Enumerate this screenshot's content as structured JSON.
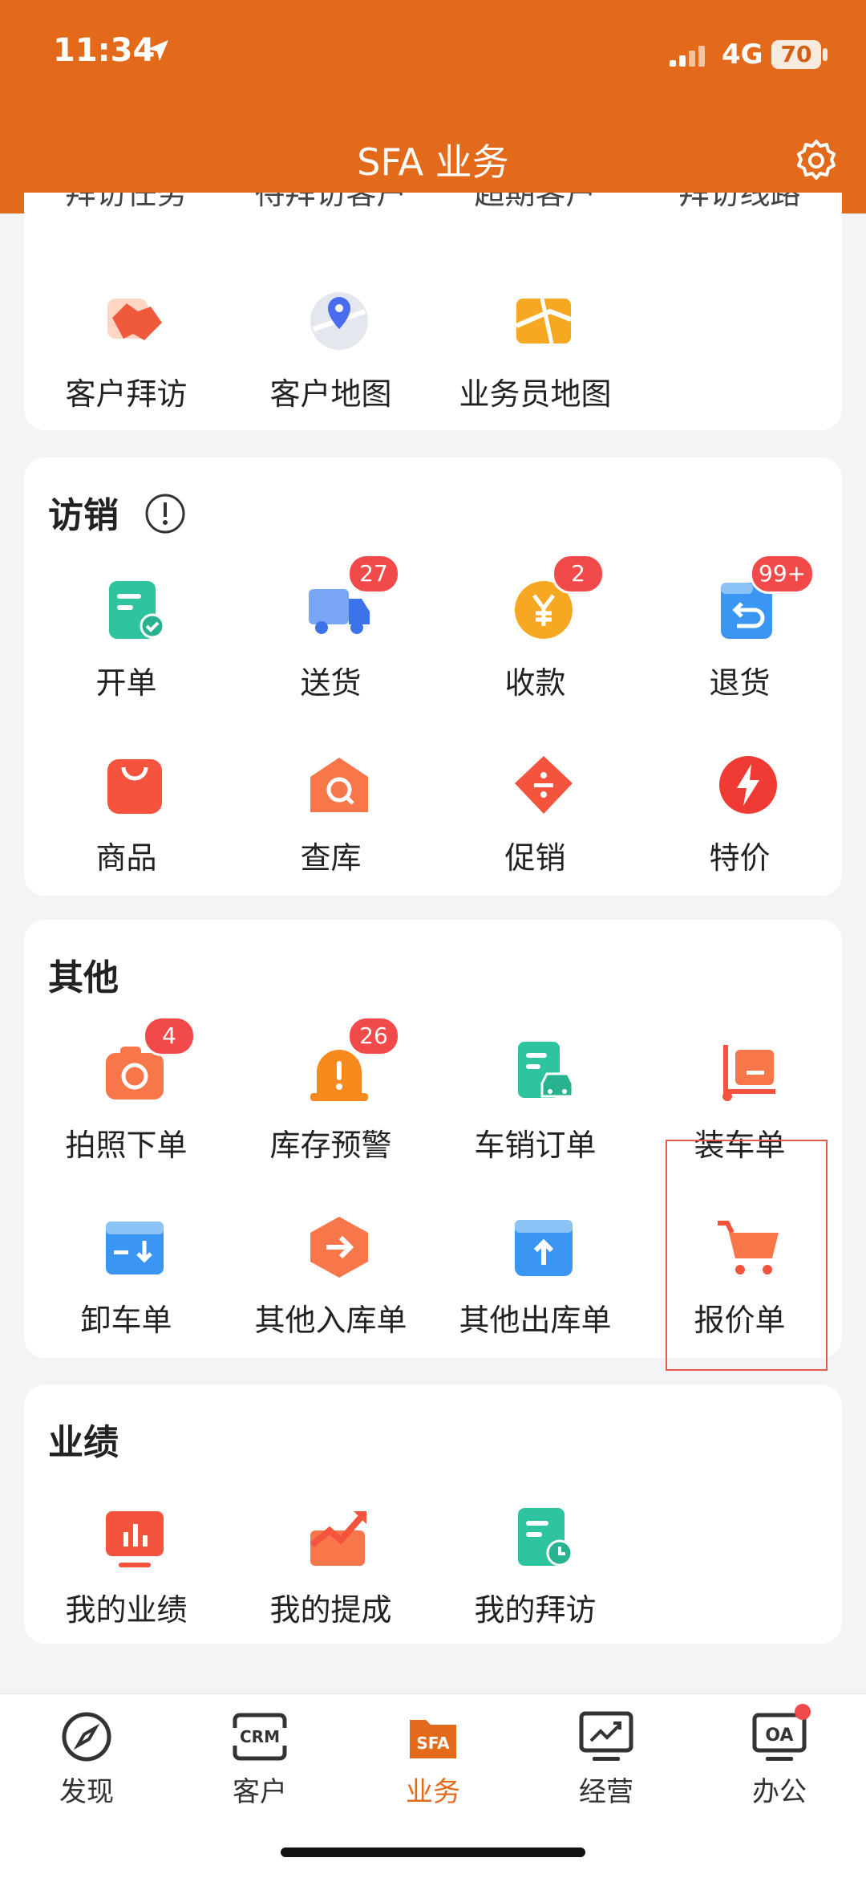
{
  "status": {
    "time": "11:34",
    "network": "4G",
    "battery": "70"
  },
  "header": {
    "title": "SFA 业务"
  },
  "top_card": {
    "clipped_labels": [
      "拜访任务",
      "待拜访客户",
      "超期客户",
      "拜访线路"
    ],
    "items": [
      {
        "label": "客户拜访",
        "icon": "handshake-icon"
      },
      {
        "label": "客户地图",
        "icon": "map-pin-icon"
      },
      {
        "label": "业务员地图",
        "icon": "map-icon"
      }
    ]
  },
  "visit": {
    "title": "访销",
    "items": [
      {
        "label": "开单",
        "icon": "order-icon",
        "badge": ""
      },
      {
        "label": "送货",
        "icon": "truck-icon",
        "badge": "27"
      },
      {
        "label": "收款",
        "icon": "yen-icon",
        "badge": "2"
      },
      {
        "label": "退货",
        "icon": "return-icon",
        "badge": "99+"
      },
      {
        "label": "商品",
        "icon": "bag-icon",
        "badge": ""
      },
      {
        "label": "查库",
        "icon": "warehouse-search-icon",
        "badge": ""
      },
      {
        "label": "促销",
        "icon": "tag-icon",
        "badge": ""
      },
      {
        "label": "特价",
        "icon": "lightning-icon",
        "badge": ""
      }
    ]
  },
  "other": {
    "title": "其他",
    "items": [
      {
        "label": "拍照下单",
        "icon": "camera-icon",
        "badge": "4"
      },
      {
        "label": "库存预警",
        "icon": "alarm-icon",
        "badge": "26"
      },
      {
        "label": "车销订单",
        "icon": "car-order-icon",
        "badge": ""
      },
      {
        "label": "装车单",
        "icon": "cart-load-icon",
        "badge": ""
      },
      {
        "label": "卸车单",
        "icon": "unload-icon",
        "badge": ""
      },
      {
        "label": "其他入库单",
        "icon": "arrow-in-icon",
        "badge": ""
      },
      {
        "label": "其他出库单",
        "icon": "box-out-icon",
        "badge": ""
      },
      {
        "label": "报价单",
        "icon": "shopping-cart-icon",
        "badge": ""
      }
    ]
  },
  "performance": {
    "title": "业绩",
    "items": [
      {
        "label": "我的业绩",
        "icon": "chart-icon"
      },
      {
        "label": "我的提成",
        "icon": "trend-icon"
      },
      {
        "label": "我的拜访",
        "icon": "visit-log-icon"
      }
    ]
  },
  "tabs": [
    {
      "label": "发现",
      "icon_text": ""
    },
    {
      "label": "客户",
      "icon_text": "CRM"
    },
    {
      "label": "业务",
      "icon_text": "SFA"
    },
    {
      "label": "经营",
      "icon_text": ""
    },
    {
      "label": "办公",
      "icon_text": "OA"
    }
  ],
  "colors": {
    "accent": "#e36a1a",
    "badge": "#f24a4a"
  }
}
